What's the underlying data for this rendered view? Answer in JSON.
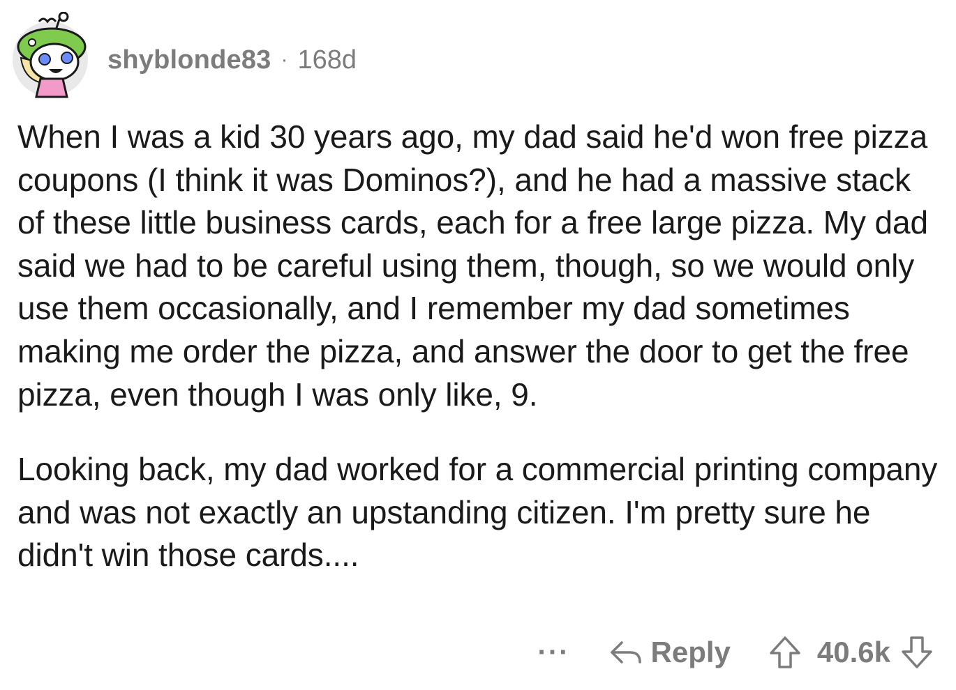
{
  "comment": {
    "author": "shyblonde83",
    "separator": "·",
    "age": "168d",
    "paragraphs": [
      "When I was a kid 30 years ago, my dad said he'd won free pizza coupons (I think it was Dominos?), and he had a massive stack of these little business cards, each for a free large pizza. My dad said we had to be careful using them, though, so we would only use them occasionally, and I remember my dad sometimes making me order the pizza, and answer the door to get the free pizza, even though I was only like, 9.",
      "Looking back, my dad worked for a commercial printing company and was not exactly an upstanding citizen. I'm pretty sure he didn't win those cards...."
    ]
  },
  "actions": {
    "more_label": "···",
    "reply_label": "Reply",
    "score": "40.6k"
  },
  "icons": {
    "avatar": "snoo-avatar-icon",
    "reply": "reply-arrow-icon",
    "upvote": "upvote-arrow-icon",
    "downvote": "downvote-arrow-icon",
    "more": "more-options-icon"
  },
  "colors": {
    "text": "#1a1a1b",
    "meta": "#7c7c7c",
    "avatar_bg": "#e9e9e9",
    "avatar_hat": "#7ecb4e"
  }
}
